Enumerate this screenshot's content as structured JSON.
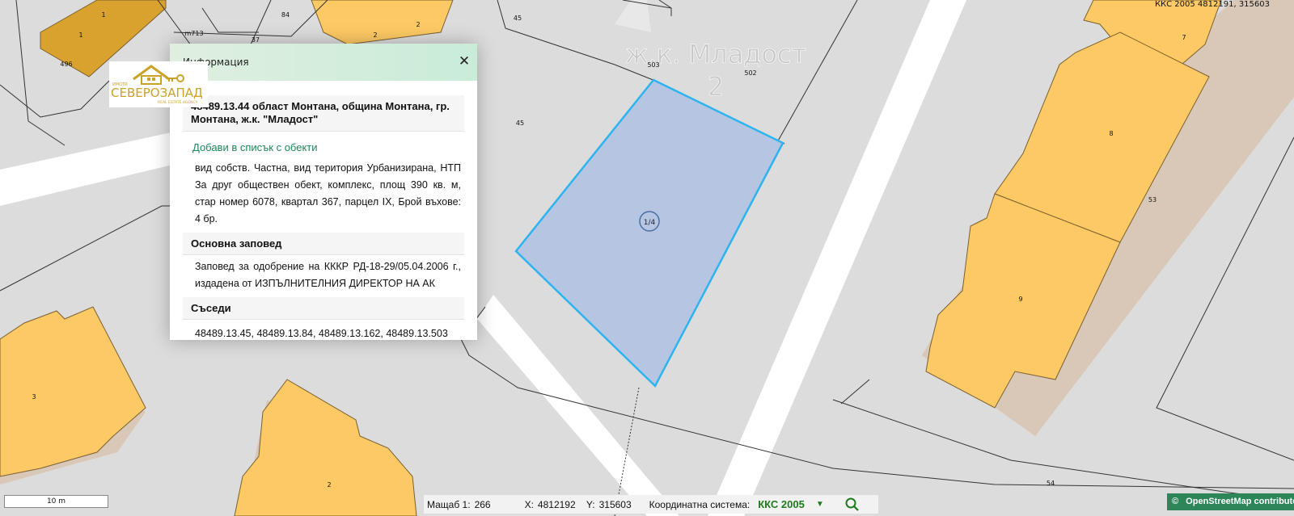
{
  "map": {
    "coord_readout": "ККС 2005 4812191, 315603",
    "district_label_line1": "ж.к. Младост",
    "district_label_line2": "2",
    "parcel_labels": {
      "p1a": "1",
      "p1b": "1",
      "p496": "496",
      "pm713": "m713",
      "p37": "37",
      "p84": "84",
      "p2a": "2",
      "p2b": "2",
      "p45a": "45",
      "p45b": "45",
      "p503": "503",
      "p502": "502",
      "p7": "7",
      "p8": "8",
      "p53": "53",
      "p9": "9",
      "p3": "3",
      "p2c": "2",
      "p54": "54",
      "selected": "1/4"
    },
    "colors": {
      "background": "#dcdcdc",
      "building": "#fdc964",
      "building_dark": "#d9a22e",
      "selected_fill": "#b6c6e2",
      "selected_stroke": "#2db4f0",
      "road": "#ffffff"
    }
  },
  "popup": {
    "title": "Информация",
    "close_icon": "close-icon",
    "parcel_title": "48489.13.44 област Монтана, община Монтана, гр. Монтана, ж.к. \"Младост\"",
    "add_link": "Добави в списък с обекти",
    "description": "вид собств. Частна, вид територия Урбанизирана, НТП За друг обществен обект, комплекс, площ 390 кв. м, стар номер 6078, квартал 367, парцел IX, Брой въхове: 4 бр.",
    "order_title": "Основна заповед",
    "order_text": "Заповед за одобрение на КККР РД-18-29/05.04.2006 г., издадена от ИЗПЪЛНИТЕЛНИЯ ДИРЕКТОР НА АК",
    "neighbors_title": "Съседи",
    "neighbors_text": "48489.13.45, 48489.13.84, 48489.13.162, 48489.13.503"
  },
  "logo": {
    "small_text": "ИМОТИ",
    "name": "СЕВЕРОЗАПАД",
    "tagline": "REAL ESTATE AGENCY"
  },
  "scale_bar": {
    "label": "10 m"
  },
  "bottom_bar": {
    "scale_label": "Мащаб 1:",
    "scale_value": "266",
    "x_label": "X:",
    "x_value": "4812192",
    "y_label": "Y:",
    "y_value": "315603",
    "crs_label": "Координатна система:",
    "crs_value": "ККС 2005",
    "dropdown_icon": "chevron-down-icon",
    "search_icon": "search-icon"
  },
  "attribution": {
    "symbol": "©",
    "text": "OpenStreetMap contributors"
  }
}
